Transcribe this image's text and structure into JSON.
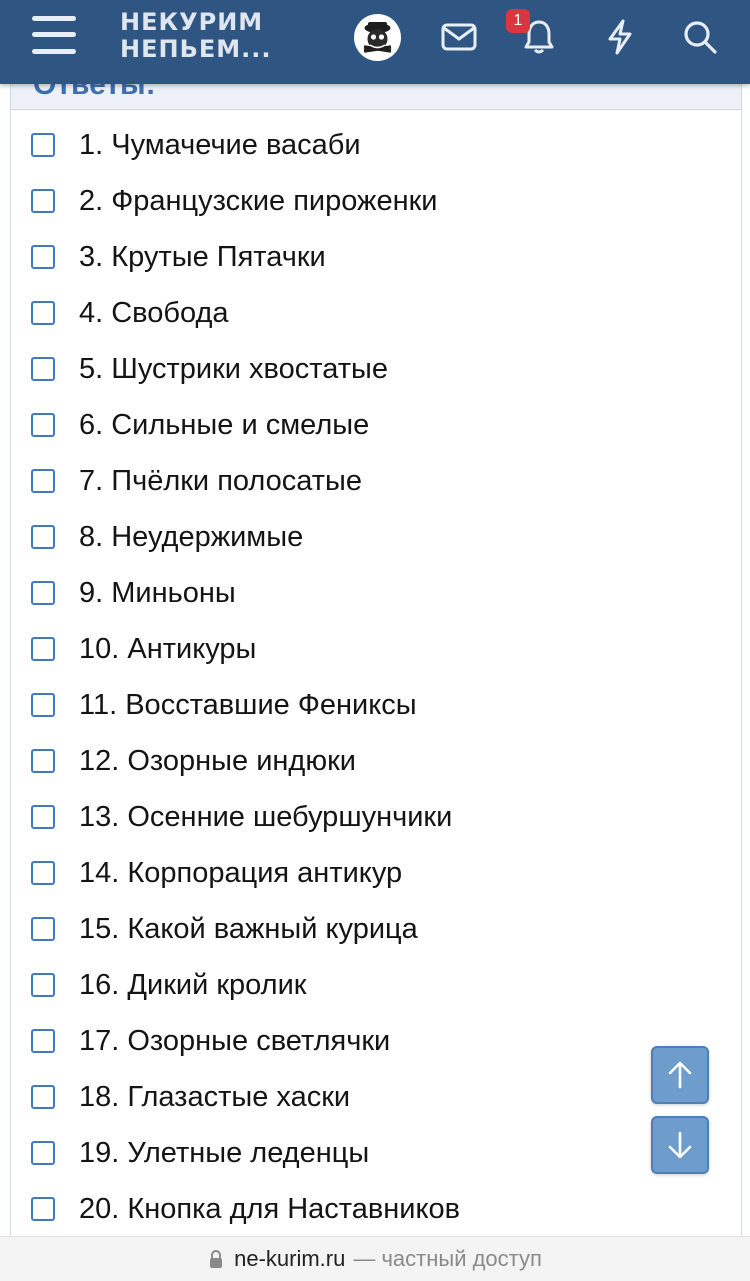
{
  "header": {
    "logo_line1": "НЕКУРИМ",
    "logo_line2": "НЕПЬЕМ...",
    "notification_count": "1",
    "icons": [
      "menu-icon",
      "avatar",
      "mail-icon",
      "bell-icon",
      "lightning-icon",
      "search-icon"
    ]
  },
  "section_title": "Ответы:",
  "options": [
    "1. Чумачечие васаби",
    "2. Французские пироженки",
    "3. Крутые Пятачки",
    "4. Свобода",
    "5. Шустрики хвостатые",
    "6. Сильные и смелые",
    "7. Пчёлки полосатые",
    "8. Неудержимые",
    "9. Миньоны",
    "10. Антикуры",
    "11. Восставшие Фениксы",
    "12. Озорные индюки",
    "13. Осенние шебуршунчики",
    "14. Корпорация антикур",
    "15. Какой важный курица",
    "16. Дикий кролик",
    "17. Озорные светлячки",
    "18. Глазастые хаски",
    "19. Улетные леденцы",
    "20. Кнопка для Наставников"
  ],
  "footer": {
    "domain": "ne-kurim.ru",
    "suffix": "— частный доступ"
  },
  "colors": {
    "header_bg": "#2f5683",
    "accent": "#3e79c2",
    "badge": "#d8373f",
    "scroll_button": "#6e9ccd"
  }
}
